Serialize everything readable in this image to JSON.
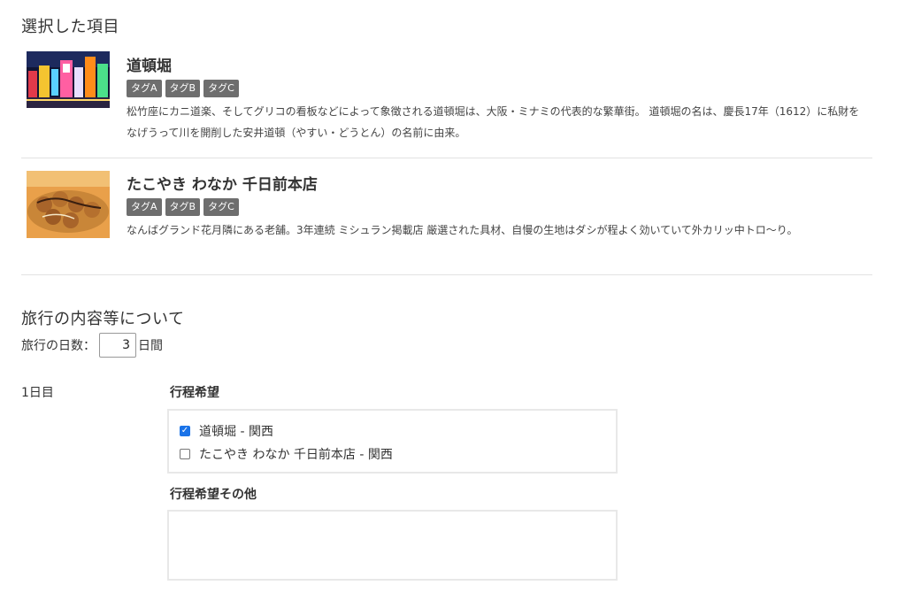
{
  "selected_section": {
    "title": "選択した項目",
    "items": [
      {
        "title": "道頓堀",
        "tags": [
          "タグA",
          "タグB",
          "タグC"
        ],
        "description": "松竹座にカニ道楽、そしてグリコの看板などによって象徴される道頓堀は、大阪・ミナミの代表的な繁華街。 道頓堀の名は、慶長17年（1612）に私財をなげうって川を開削した安井道頓（やすい・どうとん）の名前に由来。",
        "image": "dotonbori-night-neon-photo"
      },
      {
        "title": "たこやき わなか 千日前本店",
        "tags": [
          "タグA",
          "タグB",
          "タグC"
        ],
        "description": "なんばグランド花月隣にある老舗。3年連続 ミシュラン掲載店 厳選された具材、自慢の生地はダシが程よく効いていて外カリッ中トロ〜り。",
        "image": "takoyaki-photo"
      }
    ]
  },
  "trip_section": {
    "title": "旅行の内容等について",
    "days_label": "旅行の日数：",
    "days_value": "3",
    "days_unit": "日間",
    "days": [
      {
        "label": "1日目",
        "itinerary_label": "行程希望",
        "options": [
          {
            "label": "道頓堀 - 関西",
            "checked": true
          },
          {
            "label": "たこやき わなか 千日前本店 - 関西",
            "checked": false
          }
        ],
        "other_label": "行程希望その他",
        "other_value": ""
      }
    ]
  },
  "colors": {
    "tag_bg": "#6e6e6e",
    "checkbox_checked": "#1a73e8",
    "divider": "#e2e2e2"
  }
}
